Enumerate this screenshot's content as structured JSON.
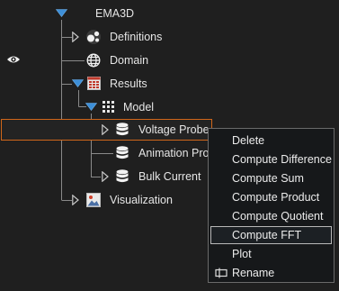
{
  "tree": {
    "root": "EMA3D",
    "items": [
      {
        "label": "Definitions",
        "icon": "definitions-icon"
      },
      {
        "label": "Domain",
        "icon": "globe-icon"
      },
      {
        "label": "Results",
        "icon": "results-table-icon"
      },
      {
        "label": "Model",
        "icon": "grid-icon"
      },
      {
        "label": "Voltage Probe",
        "icon": "database-icon"
      },
      {
        "label": "Animation Pro",
        "icon": "database-icon"
      },
      {
        "label": "Bulk Current",
        "icon": "database-icon"
      },
      {
        "label": "Visualization",
        "icon": "image-icon"
      }
    ]
  },
  "context_menu": {
    "items": [
      "Delete",
      "Compute Difference",
      "Compute Sum",
      "Compute Product",
      "Compute Quotient",
      "Compute FFT",
      "Plot",
      "Rename"
    ],
    "active": "Compute FFT"
  },
  "colors": {
    "background": "#1f1f1f",
    "selection_border": "#d0661a",
    "expand_arrow_blue": "#3d8fd8",
    "menu_bg": "#16181a"
  }
}
